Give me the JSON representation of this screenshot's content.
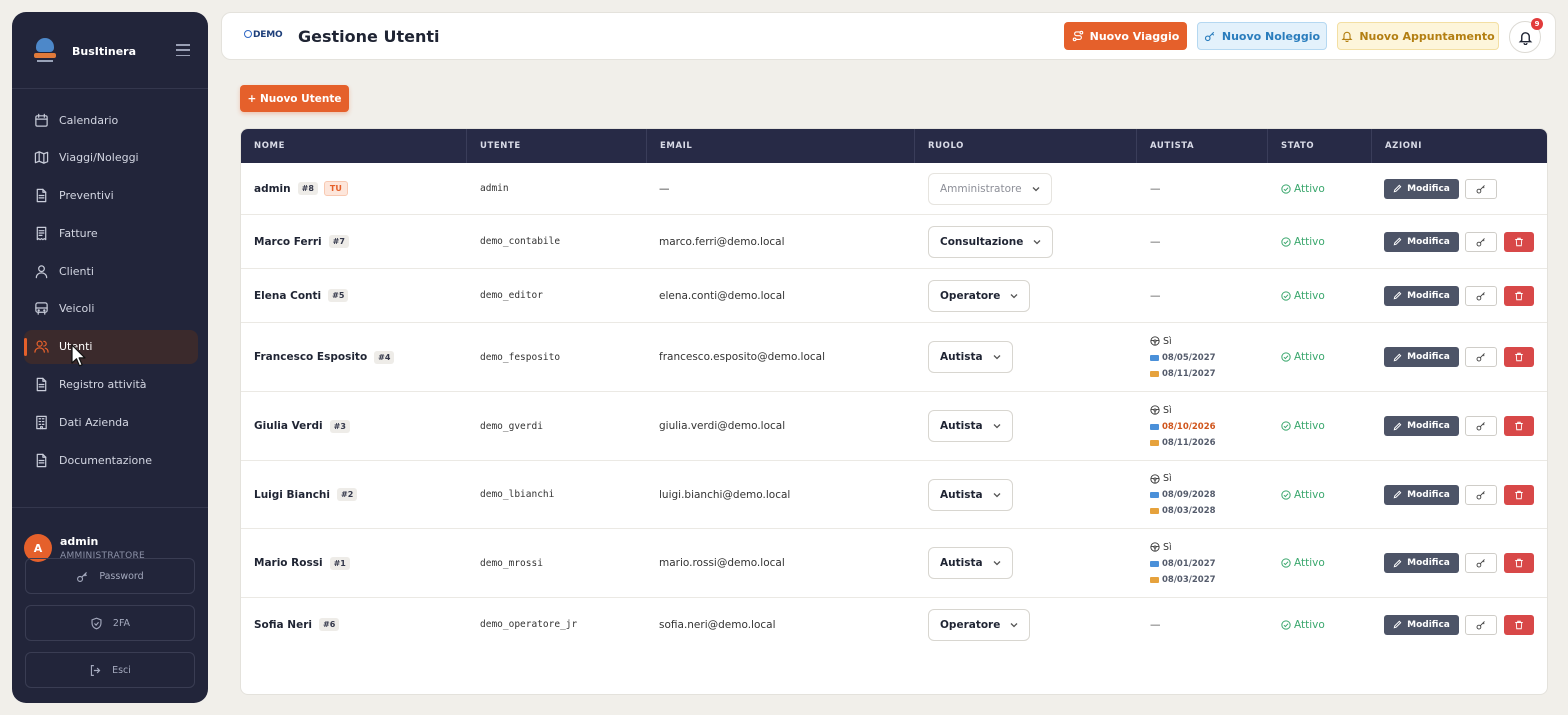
{
  "app": {
    "name": "BusItinera"
  },
  "sidebar": {
    "items": [
      {
        "label": "Calendario",
        "icon": "calendar-icon"
      },
      {
        "label": "Viaggi/Noleggi",
        "icon": "map-icon"
      },
      {
        "label": "Preventivi",
        "icon": "document-icon"
      },
      {
        "label": "Fatture",
        "icon": "receipt-icon"
      },
      {
        "label": "Clienti",
        "icon": "user-icon"
      },
      {
        "label": "Veicoli",
        "icon": "bus-icon"
      },
      {
        "label": "Utenti",
        "icon": "users-icon",
        "active": true
      },
      {
        "label": "Registro attività",
        "icon": "document-icon"
      },
      {
        "label": "Dati Azienda",
        "icon": "building-icon"
      },
      {
        "label": "Documentazione",
        "icon": "document-icon"
      }
    ],
    "user": {
      "initial": "A",
      "name": "admin",
      "role": "AMMINISTRATORE"
    },
    "password_label": "Password",
    "twofa_label": "2FA",
    "logout_label": "Esci"
  },
  "header": {
    "logo_text": "DEMO",
    "title": "Gestione Utenti",
    "btn_viaggio": "Nuovo Viaggio",
    "btn_noleggio": "Nuovo Noleggio",
    "btn_appuntamento": "Nuovo Appuntamento",
    "notifications": "9"
  },
  "new_user_label": "+ Nuovo Utente",
  "table": {
    "columns": [
      "NOME",
      "UTENTE",
      "EMAIL",
      "RUOLO",
      "AUTISTA",
      "STATO",
      "AZIONI"
    ],
    "edit_label": "Modifica",
    "you_label": "TU",
    "rows": [
      {
        "name": "admin",
        "id": "#8",
        "you": true,
        "username": "admin",
        "email": "—",
        "role": "Amministratore",
        "role_disabled": true,
        "driver": null,
        "status": "Attivo",
        "deletable": false
      },
      {
        "name": "Marco Ferri",
        "id": "#7",
        "username": "demo_contabile",
        "email": "marco.ferri@demo.local",
        "role": "Consultazione",
        "driver": null,
        "status": "Attivo",
        "deletable": true
      },
      {
        "name": "Elena Conti",
        "id": "#5",
        "username": "demo_editor",
        "email": "elena.conti@demo.local",
        "role": "Operatore",
        "driver": null,
        "status": "Attivo",
        "deletable": true
      },
      {
        "name": "Francesco Esposito",
        "id": "#4",
        "username": "demo_fesposito",
        "email": "francesco.esposito@demo.local",
        "role": "Autista",
        "driver": {
          "label": "Sì",
          "license": "08/05/2027",
          "cqc": "08/11/2027"
        },
        "status": "Attivo",
        "deletable": true
      },
      {
        "name": "Giulia Verdi",
        "id": "#3",
        "username": "demo_gverdi",
        "email": "giulia.verdi@demo.local",
        "role": "Autista",
        "driver": {
          "label": "Sì",
          "license": "08/10/2026",
          "license_warn": true,
          "cqc": "08/11/2026"
        },
        "status": "Attivo",
        "deletable": true
      },
      {
        "name": "Luigi Bianchi",
        "id": "#2",
        "username": "demo_lbianchi",
        "email": "luigi.bianchi@demo.local",
        "role": "Autista",
        "driver": {
          "label": "Sì",
          "license": "08/09/2028",
          "cqc": "08/03/2028"
        },
        "status": "Attivo",
        "deletable": true
      },
      {
        "name": "Mario Rossi",
        "id": "#1",
        "username": "demo_mrossi",
        "email": "mario.rossi@demo.local",
        "role": "Autista",
        "driver": {
          "label": "Sì",
          "license": "08/01/2027",
          "cqc": "08/03/2027"
        },
        "status": "Attivo",
        "deletable": true
      },
      {
        "name": "Sofia Neri",
        "id": "#6",
        "username": "demo_operatore_jr",
        "email": "sofia.neri@demo.local",
        "role": "Operatore",
        "driver": null,
        "status": "Attivo",
        "deletable": true
      }
    ],
    "empty_driver": "—"
  },
  "colors": {
    "accent": "#e5602b",
    "sidebar_bg": "#22253a",
    "success": "#3aa76d",
    "danger": "#d84848"
  }
}
